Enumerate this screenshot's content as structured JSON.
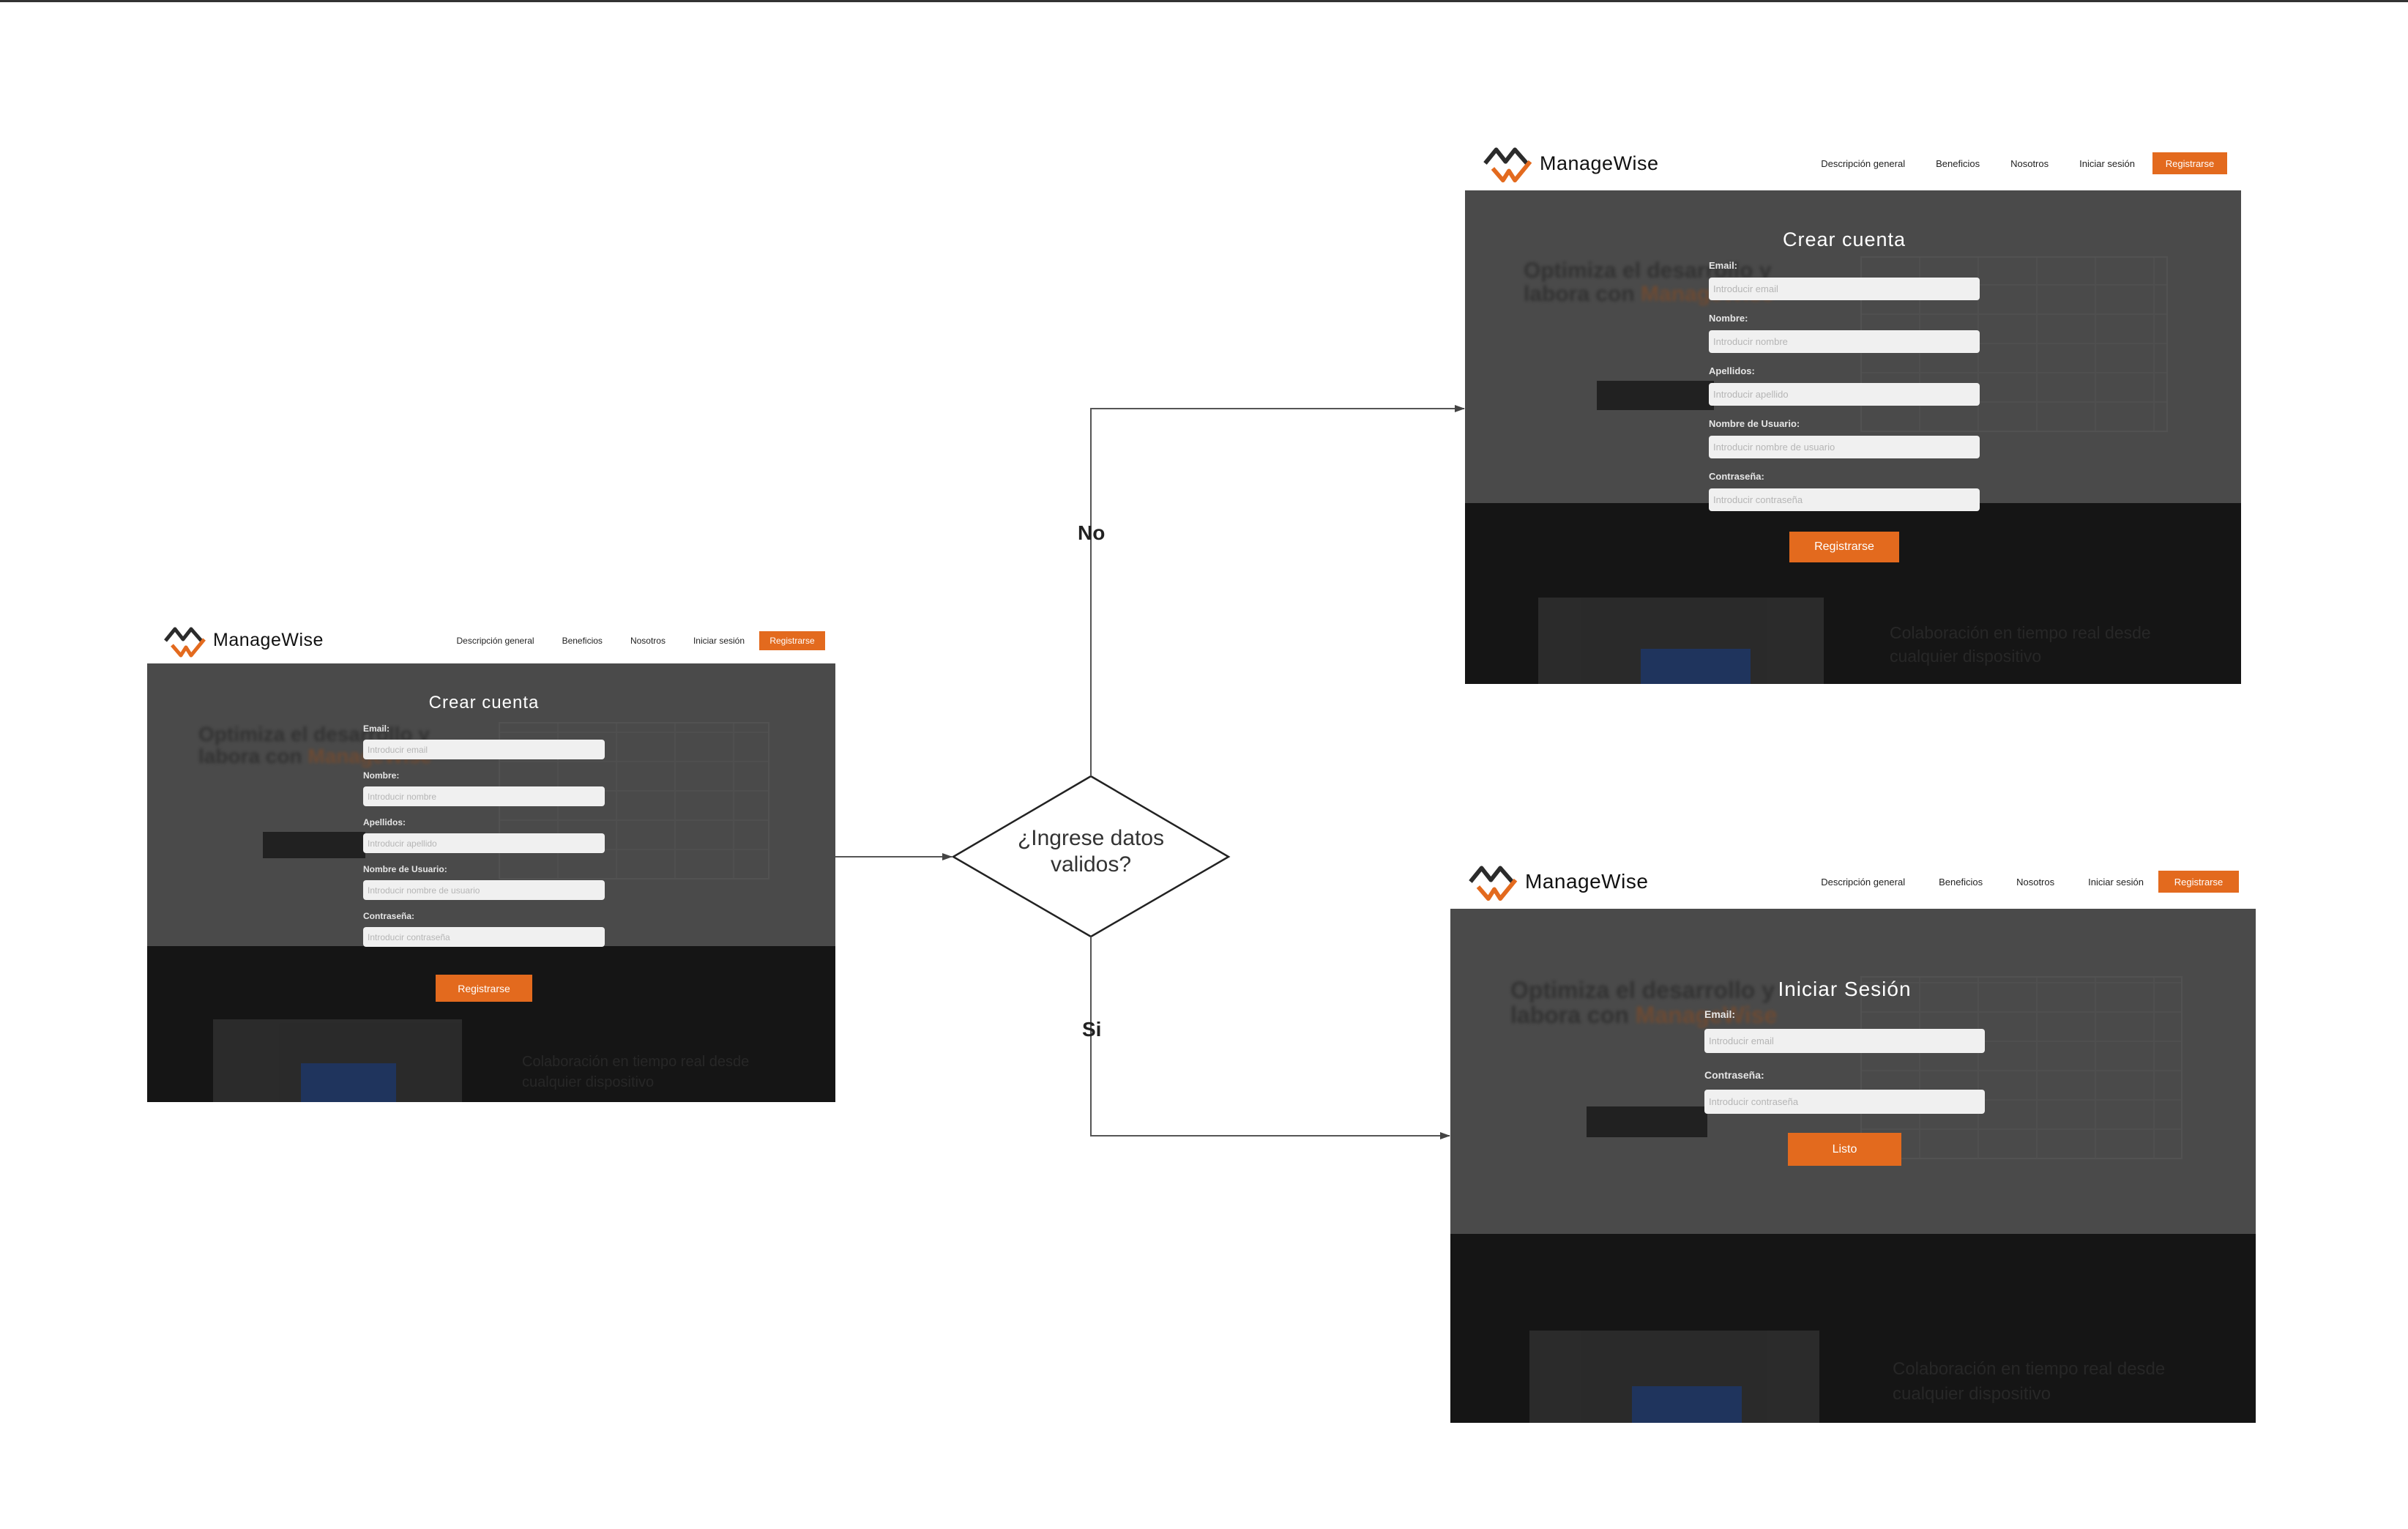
{
  "brand": {
    "name": "ManageWise",
    "accent": "#e36a1e",
    "dark": "#151515",
    "overlay": "#4a4a4a"
  },
  "nav": {
    "items": [
      "Descripción general",
      "Beneficios",
      "Nosotros",
      "Iniciar sesión"
    ],
    "cta": "Registrarse"
  },
  "decision": {
    "text_line1": "¿Ingrese datos",
    "text_line2": "validos?"
  },
  "branches": {
    "no": "No",
    "yes": "Si"
  },
  "register_screen": {
    "title": "Crear cuenta",
    "fields": [
      {
        "label": "Email:",
        "placeholder": "Introducir email"
      },
      {
        "label": "Nombre:",
        "placeholder": "Introducir nombre"
      },
      {
        "label": "Apellidos:",
        "placeholder": "Introducir apellido"
      },
      {
        "label": "Nombre de Usuario:",
        "placeholder": "Introducir nombre de usuario"
      },
      {
        "label": "Contraseña:",
        "placeholder": "Introducir contraseña"
      }
    ],
    "submit": "Registrarse"
  },
  "login_screen": {
    "title": "Iniciar Sesión",
    "fields": [
      {
        "label": "Email:",
        "placeholder": "Introducir email"
      },
      {
        "label": "Contraseña:",
        "placeholder": "Introducir contraseña"
      }
    ],
    "submit": "Listo"
  }
}
